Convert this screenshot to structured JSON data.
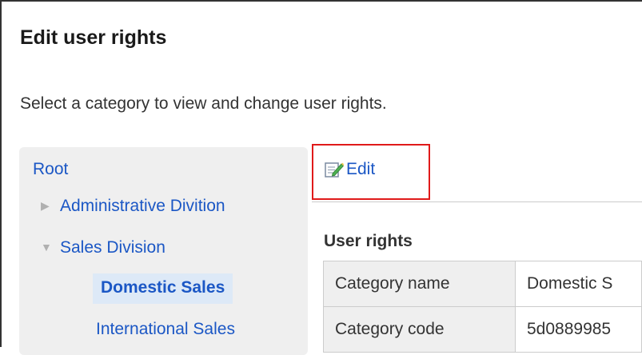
{
  "page": {
    "title": "Edit user rights",
    "description": "Select a category to view and change user rights."
  },
  "tree": {
    "root": "Root",
    "items": [
      {
        "label": "Administrative Divition",
        "toggle": "▶",
        "expanded": false
      },
      {
        "label": "Sales Division",
        "toggle": "▼",
        "expanded": true
      },
      {
        "label": "Domestic Sales",
        "selected": true
      },
      {
        "label": "International Sales"
      }
    ]
  },
  "actions": {
    "edit_label": "Edit",
    "edit_icon": "edit-note-icon",
    "highlight_color": "#e01a1a"
  },
  "section": {
    "title": "User rights"
  },
  "table": {
    "rows": [
      {
        "label": "Category name",
        "value": "Domestic S"
      },
      {
        "label": "Category code",
        "value": "5d0889985"
      }
    ]
  },
  "colors": {
    "link": "#1b57c5",
    "panel_bg": "#efefef",
    "selected_bg": "#dde9f7"
  }
}
